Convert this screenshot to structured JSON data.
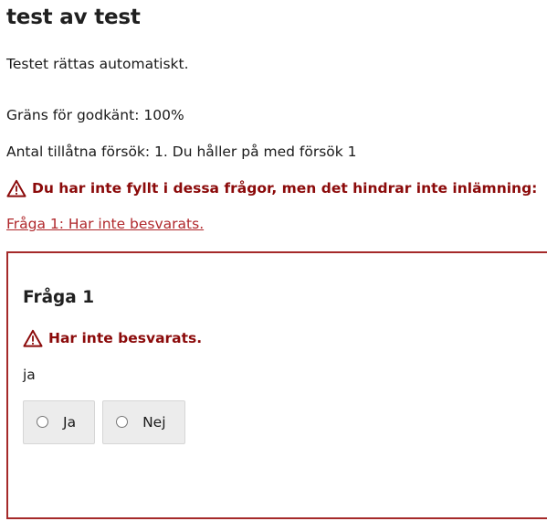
{
  "title": "test av test",
  "info": {
    "auto_grade": "Testet rättas automatiskt.",
    "pass_limit": "Gräns för godkänt: 100%",
    "attempts": "Antal tillåtna försök: 1. Du håller på med försök 1"
  },
  "warning": {
    "text": "Du har inte fyllt i dessa frågor, men det hindrar inte inlämning:",
    "icon": "warning-triangle-icon"
  },
  "unanswered_link": "Fråga 1: Har inte besvarats.",
  "question": {
    "title": "Fråga 1",
    "status": "Har inte besvarats.",
    "text": "ja",
    "options": [
      {
        "label": "Ja",
        "selected": false
      },
      {
        "label": "Nej",
        "selected": false
      }
    ]
  },
  "colors": {
    "warning_text": "#8b0a0a",
    "link": "#b0282c",
    "box_border": "#a52a2a",
    "option_bg": "#ececec"
  }
}
